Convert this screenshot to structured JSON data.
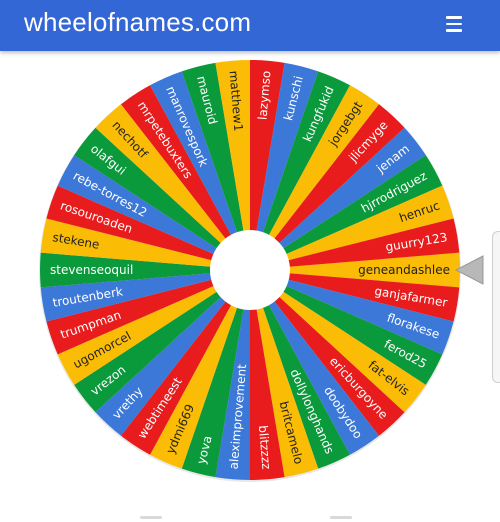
{
  "header": {
    "title": "wheelofnames.com",
    "menu_icon": "hamburger-menu-icon"
  },
  "wheel": {
    "segment_colors": [
      "#fbbc05",
      "#e81c1c",
      "#3c78d8",
      "#0b9a3b"
    ],
    "hub_color": "#ffffff",
    "pointer_color": "#b8b8b8",
    "entries": [
      "geneandashlee",
      "ganjafarmer",
      "florakese",
      "ferod25",
      "fat-elvis",
      "ericburgoyne",
      "doobydoo",
      "dollylonghands",
      "britcamelo",
      "blitzzzz",
      "alexim​provement",
      "yova",
      "ydmi669",
      "webtimeest",
      "vrethy",
      "vrezon",
      "ugomorcel",
      "trumpman",
      "troutenberk",
      "stevenseoquil",
      "stekene",
      "rosouroaden",
      "rebe-torres12",
      "olafgui",
      "nechotf",
      "mrpetebuxters",
      "manrovespork",
      "mauroid",
      "matthew1",
      "lazymso",
      "kunschi",
      "kungfukid",
      "jorgebgt",
      "jlicmyge",
      "jenam",
      "hjrrodriguez",
      "henruc",
      "guurry123"
    ]
  }
}
